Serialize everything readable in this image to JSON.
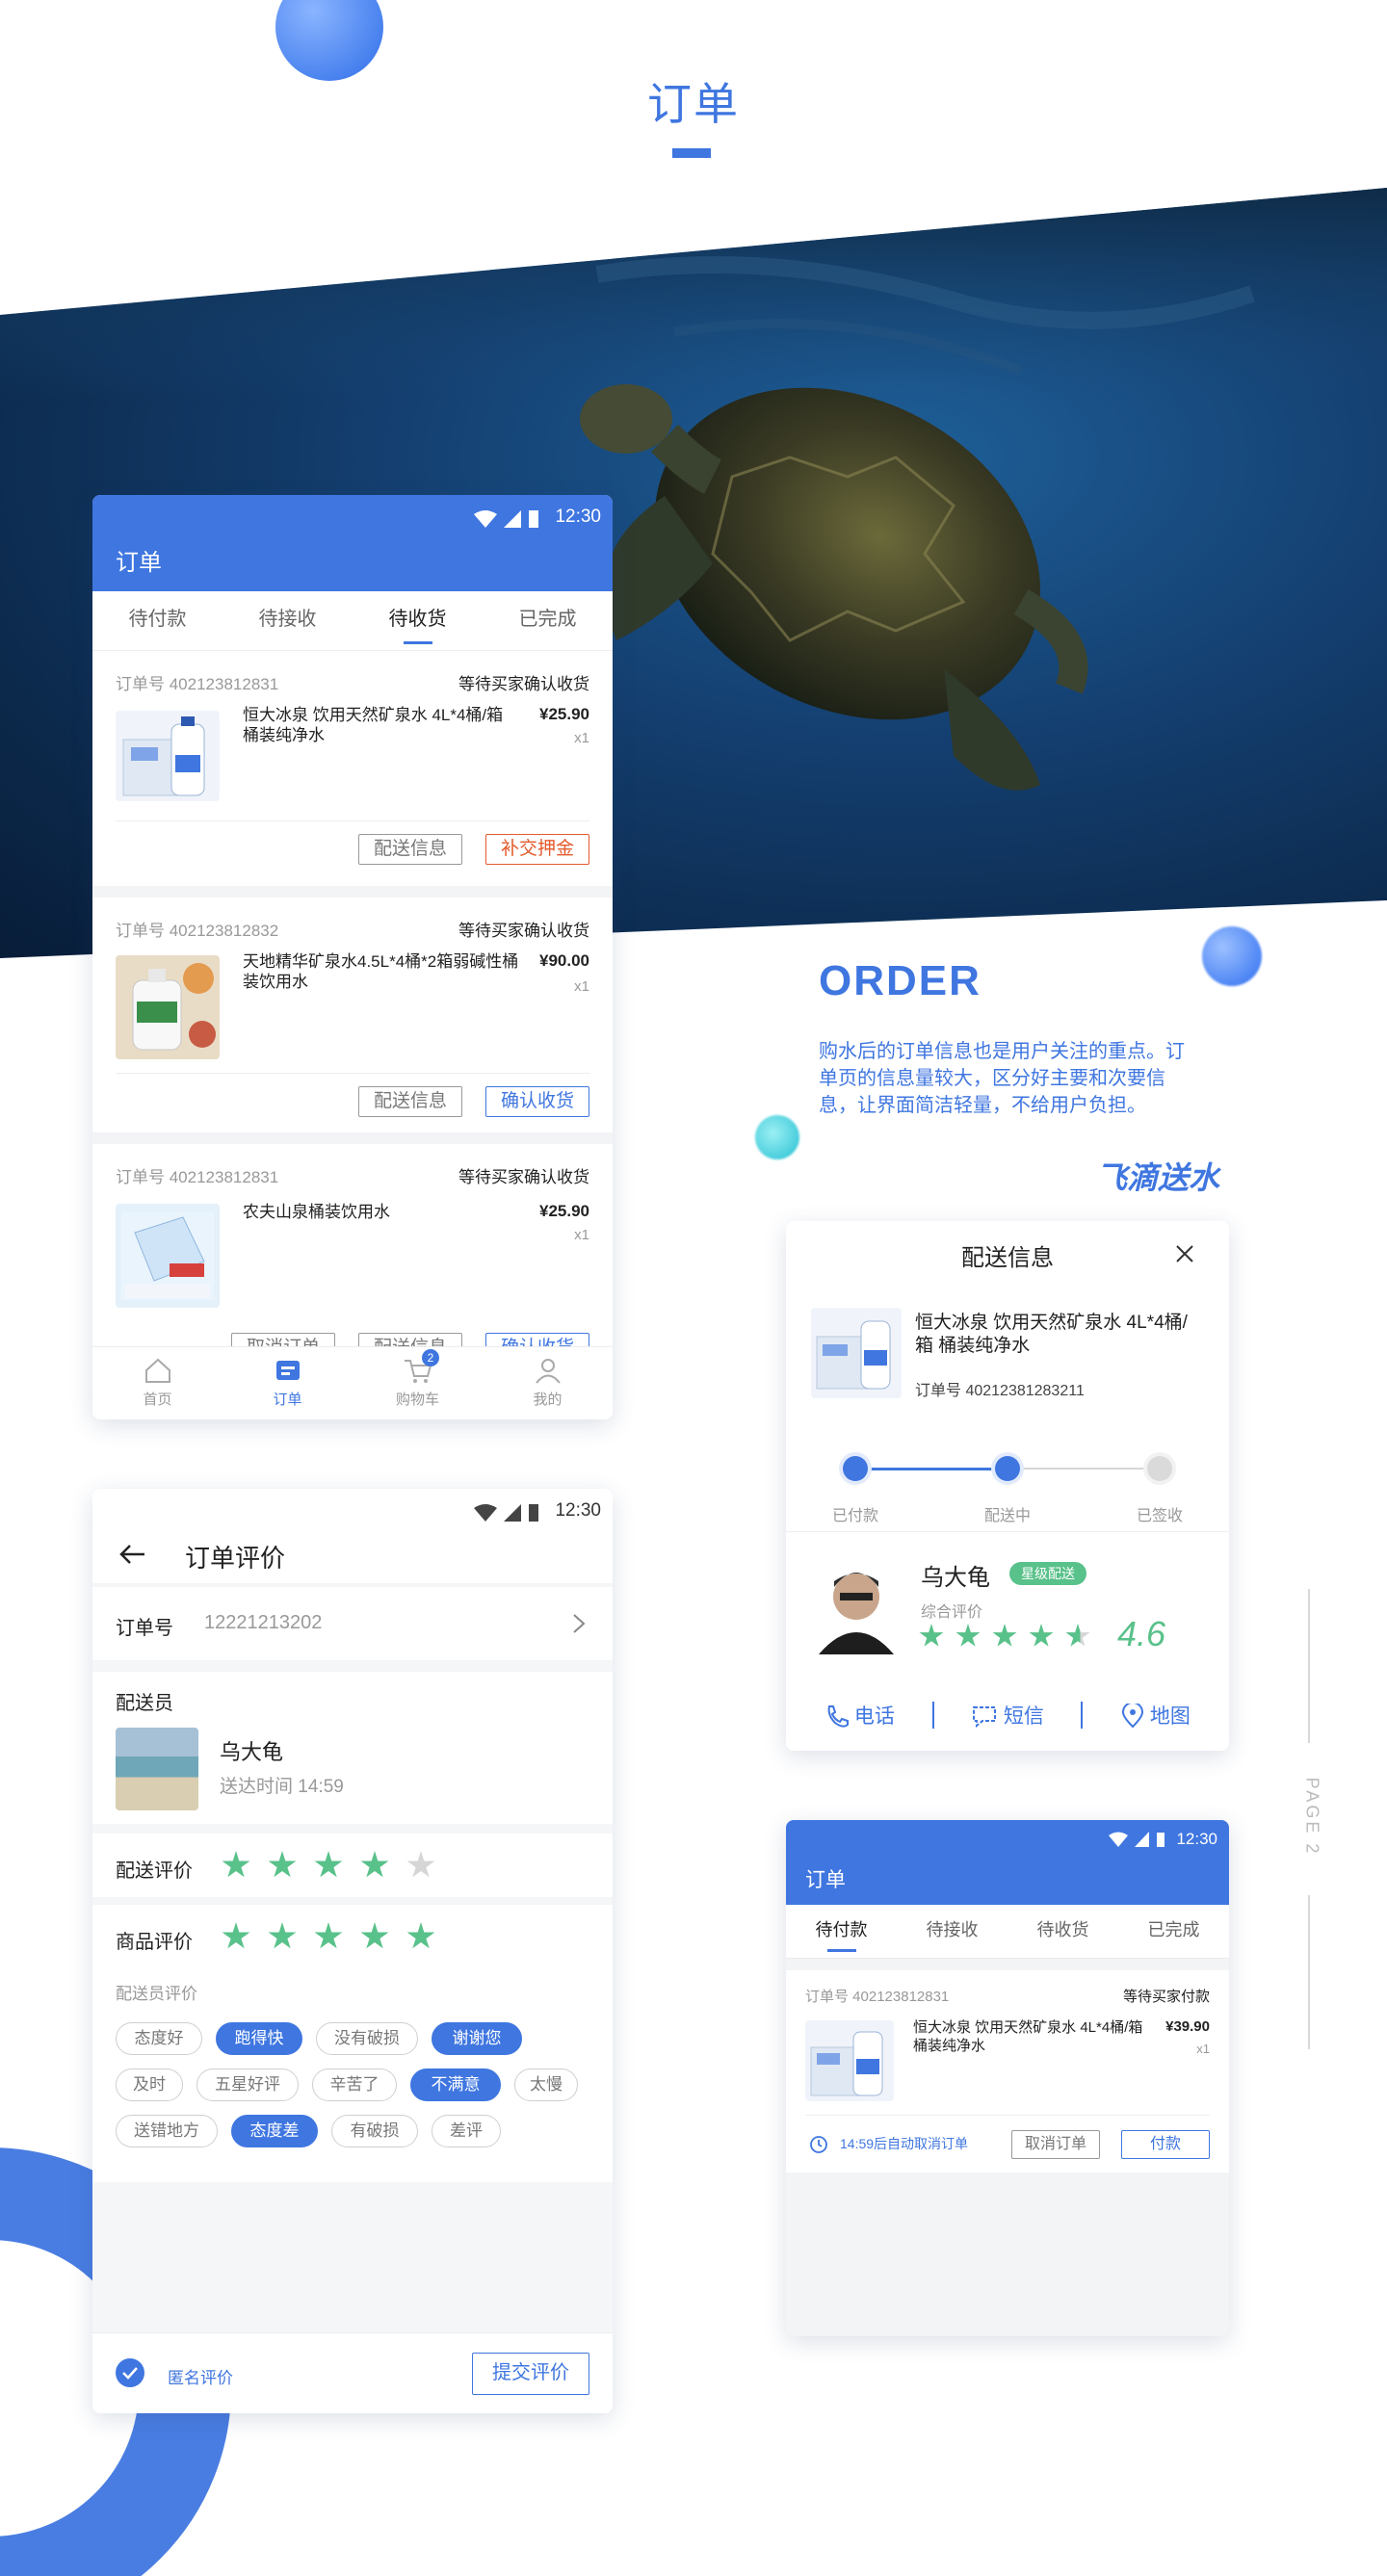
{
  "header": {
    "title": "订单"
  },
  "colors": {
    "accent": "#3f76e0",
    "green_star": "#59c18a",
    "orange": "#e35a2c"
  },
  "hero": {
    "image": "sea-turtle-underwater"
  },
  "intro": {
    "heading": "ORDER",
    "body": "购水后的订单信息也是用户关注的重点。订单页的信息量较大，区分好主要和次要信息，让界面简洁轻量，不给用户负担。",
    "brand": "飞滴送水"
  },
  "side_label": "PAGE 2",
  "screen_orders": {
    "time": "12:30",
    "title": "订单",
    "tabs": [
      "待付款",
      "待接收",
      "待收货",
      "已完成"
    ],
    "active_tab": 2,
    "orders": [
      {
        "order_no": "订单号 402123812831",
        "status": "等待买家确认收货",
        "name": "恒大冰泉 饮用天然矿泉水 4L*4桶/箱 桶装纯净水",
        "price": "¥25.90",
        "qty": "x1",
        "btn1": "配送信息",
        "btn2": "补交押金"
      },
      {
        "order_no": "订单号 402123812832",
        "status": "等待买家确认收货",
        "name": "天地精华矿泉水4.5L*4桶*2箱弱碱性桶装饮用水",
        "price": "¥90.00",
        "qty": "x1",
        "btn1": "配送信息",
        "btn2": "确认收货"
      },
      {
        "order_no": "订单号 402123812831",
        "status": "等待买家确认收货",
        "name": "农夫山泉桶装饮用水",
        "price": "¥25.90",
        "qty": "x1",
        "btn0": "取消订单",
        "btn1": "配送信息",
        "btn2": "确认收货"
      }
    ],
    "nav": [
      {
        "label": "首页",
        "icon": "home-icon"
      },
      {
        "label": "订单",
        "icon": "order-icon"
      },
      {
        "label": "购物车",
        "icon": "cart-icon",
        "badge": "2"
      },
      {
        "label": "我的",
        "icon": "user-icon"
      }
    ],
    "active_nav": 1
  },
  "screen_review": {
    "time": "12:30",
    "title": "订单评价",
    "order_label": "订单号",
    "order_no": "12221213202",
    "courier_label": "配送员",
    "courier_name": "乌大龟",
    "delivered": "送达时间 14:59",
    "delivery_rating_label": "配送评价",
    "delivery_rating": 4,
    "goods_rating_label": "商品评价",
    "goods_rating": 5,
    "tags_title": "配送员评价",
    "tags": [
      {
        "text": "态度好",
        "on": false
      },
      {
        "text": "跑得快",
        "on": true
      },
      {
        "text": "没有破损",
        "on": false
      },
      {
        "text": "谢谢您",
        "on": true
      },
      {
        "text": "及时",
        "on": false
      },
      {
        "text": "五星好评",
        "on": false
      },
      {
        "text": "辛苦了",
        "on": false
      },
      {
        "text": "不满意",
        "on": true
      },
      {
        "text": "太慢",
        "on": false
      },
      {
        "text": "送错地方",
        "on": false
      },
      {
        "text": "态度差",
        "on": true
      },
      {
        "text": "有破损",
        "on": false
      },
      {
        "text": "差评",
        "on": false
      }
    ],
    "anonymous": "匿名评价",
    "submit": "提交评价"
  },
  "screen_delivery": {
    "title": "配送信息",
    "product": "恒大冰泉 饮用天然矿泉水 4L*4桶/箱 桶装纯净水",
    "order_no": "订单号 40212381283211",
    "steps": [
      "已付款",
      "配送中",
      "已签收"
    ],
    "current_step": 2,
    "courier": {
      "name": "乌大龟",
      "badge": "星级配送",
      "rating_label": "综合评价",
      "rating": 4.6,
      "rating_text": "4.6"
    },
    "actions": [
      {
        "label": "电话",
        "icon": "phone-icon"
      },
      {
        "label": "短信",
        "icon": "message-icon"
      },
      {
        "label": "地图",
        "icon": "map-pin-icon"
      }
    ]
  },
  "screen_pending": {
    "time": "12:30",
    "title": "订单",
    "tabs": [
      "待付款",
      "待接收",
      "待收货",
      "已完成"
    ],
    "active_tab": 0,
    "order": {
      "order_no": "订单号 402123812831",
      "status": "等待买家付款",
      "name": "恒大冰泉 饮用天然矿泉水 4L*4桶/箱 桶装纯净水",
      "price": "¥39.90",
      "qty": "x1",
      "countdown": "14:59后自动取消订单",
      "cancel": "取消订单",
      "pay": "付款"
    }
  }
}
